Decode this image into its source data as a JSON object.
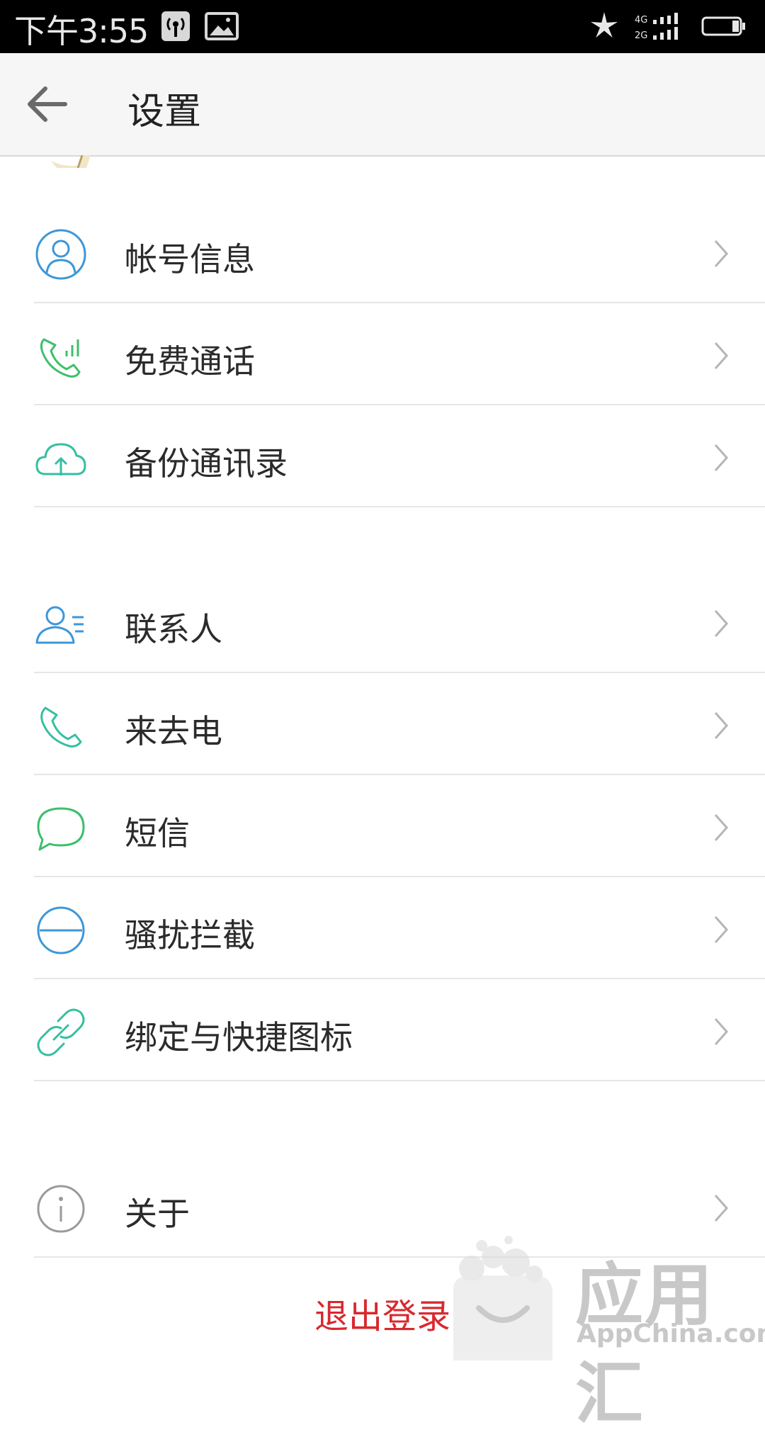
{
  "status_bar": {
    "time": "下午3:55",
    "network_4g": "4G",
    "network_2g": "2G"
  },
  "header": {
    "title": "设置"
  },
  "sections": [
    {
      "items": [
        {
          "label": "帐号信息",
          "icon": "person-icon"
        },
        {
          "label": "免费通话",
          "icon": "phone-signal-icon"
        },
        {
          "label": "备份通讯录",
          "icon": "cloud-upload-icon"
        }
      ]
    },
    {
      "items": [
        {
          "label": "联系人",
          "icon": "contacts-icon"
        },
        {
          "label": "来去电",
          "icon": "phone-icon"
        },
        {
          "label": "短信",
          "icon": "message-bubble-icon"
        },
        {
          "label": "骚扰拦截",
          "icon": "block-icon"
        },
        {
          "label": "绑定与快捷图标",
          "icon": "link-icon"
        }
      ]
    },
    {
      "items": [
        {
          "label": "关于",
          "icon": "info-icon"
        }
      ]
    }
  ],
  "logout": {
    "label": "退出登录"
  },
  "watermark": {
    "brand": "应用汇",
    "site": "AppChina.com"
  },
  "colors": {
    "blue": "#3d97d8",
    "green": "#3cbf6a",
    "teal": "#35bfa0",
    "gray": "#9a9a9a",
    "logout": "#d9282f"
  }
}
